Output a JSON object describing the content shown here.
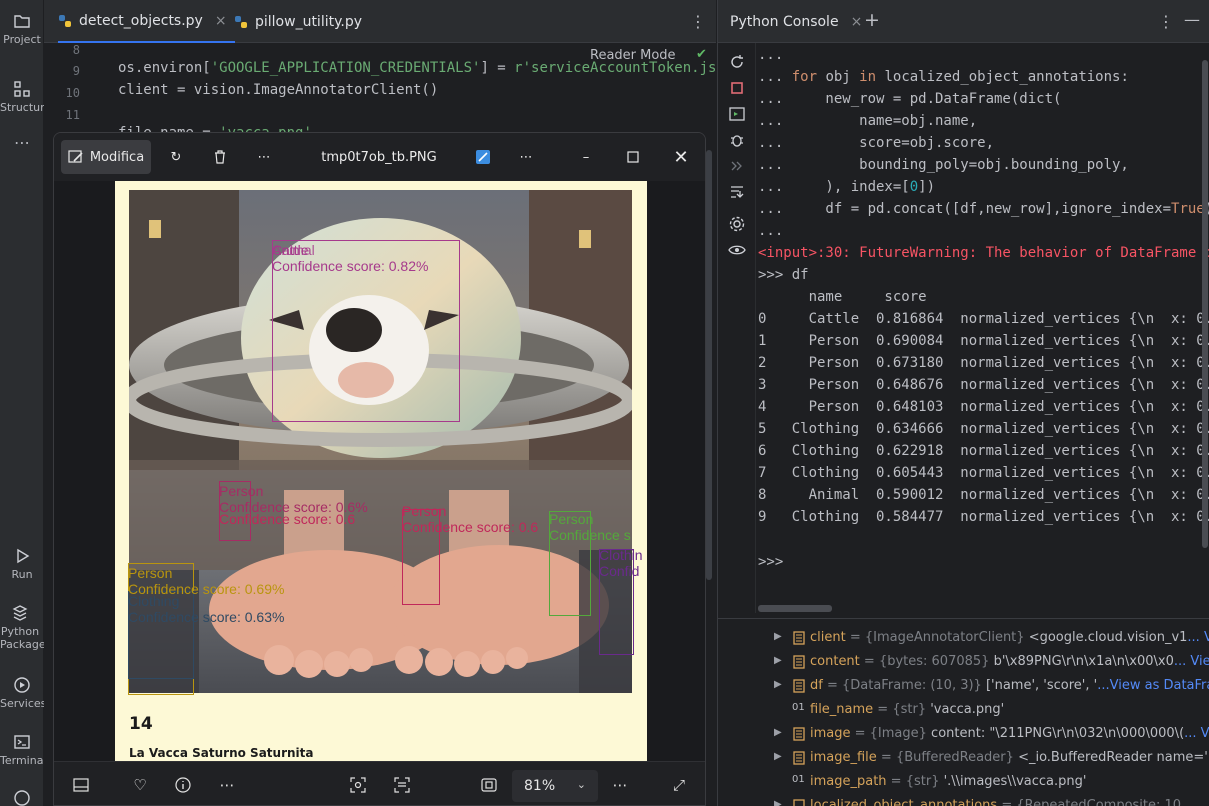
{
  "toolstrip": {
    "project": "Project",
    "structure": "Structure",
    "run": "Run",
    "python_packages": "Python Packages",
    "services": "Services",
    "terminal": "Terminal"
  },
  "editor": {
    "tabs": [
      {
        "label": "detect_objects.py"
      },
      {
        "label": "pillow_utility.py"
      }
    ],
    "reader_mode": "Reader Mode",
    "line_numbers": [
      "8",
      "9",
      "10",
      "11",
      "12"
    ],
    "line9_a": "os.environ[",
    "line9_str": "'GOOGLE_APPLICATION_CREDENTIALS'",
    "line9_b": "] = ",
    "line9_str2": "r'serviceAccountToken.json",
    "line10": "client = vision.ImageAnnotatorClient()",
    "line12_a": "file_name = ",
    "line12_str": "'vacca.png'"
  },
  "viewer": {
    "edit_label": "Modifica",
    "title": "tmp0t7ob_tb.PNG",
    "page_number": "14",
    "caption": "La Vacca Saturno Saturnita",
    "zoom": "81%",
    "detections": [
      {
        "label": "Cattle",
        "score": "Confidence score: 0.82%",
        "color": "#a63a8c"
      },
      {
        "label": "Animal",
        "score": "",
        "color": "#a63a8c"
      },
      {
        "label": "Person",
        "score": "Confidence score: 0.69%",
        "color": "#b9950f"
      },
      {
        "label": "Clothing",
        "score": "Confidence score: 0.63%",
        "color": "#2f4a63"
      },
      {
        "label": "Person",
        "score": "Confidence score: 0.6%",
        "color": "#a62c64"
      },
      {
        "label": "Person",
        "score": "Confidence score: 0.6",
        "color": "#c0285a"
      },
      {
        "label": "Person",
        "score": "Confidence s",
        "color": "#54a83c"
      },
      {
        "label": "Clothin",
        "score": "Confid",
        "color": "#6a2a8c"
      }
    ]
  },
  "console": {
    "tab_label": "Python Console",
    "lines": {
      "l0": "...",
      "l1_a": "... ",
      "l1_kw": "for",
      "l1_b": " obj ",
      "l1_kw2": "in",
      "l1_c": " localized_object_annotations:",
      "l2": "...     new_row = pd.DataFrame(dict(",
      "l3": "...         name=obj.name,",
      "l4": "...         score=obj.score,",
      "l5": "...         bounding_poly=obj.bounding_poly,",
      "l6_a": "...     ), index=[",
      "l6_num": "0",
      "l6_b": "])",
      "l7_a": "...     df = pd.concat([df,new_row],ignore_index=",
      "l7_true": "True",
      "l7_b": ")",
      "l8": "...",
      "warn": "<input>:30: FutureWarning: The behavior of DataFrame conc",
      "prompt_df": ">>> df",
      "header": "      name     score"
    },
    "rows": [
      "0     Cattle  0.816864  normalized_vertices {\\n  x: 0.2949",
      "1     Person  0.690084  normalized_vertices {\\n  x: 0.0240",
      "2     Person  0.673180  normalized_vertices {\\n  x: 0.5390",
      "3     Person  0.648676  normalized_vertices {\\n  x: 0.8164",
      "4     Person  0.648103  normalized_vertices {\\n  x: 0.1953",
      "5   Clothing  0.634666  normalized_vertices {\\n  x: 0.0244",
      "6   Clothing  0.622918  normalized_vertices {\\n  x: 0.9101",
      "7   Clothing  0.605443  normalized_vertices {\\n  x: 0.1962",
      "8     Animal  0.590012  normalized_vertices {\\n  x: 0.2949",
      "9   Clothing  0.584477  normalized_vertices {\\n  x: 0.8242"
    ],
    "prompt_empty": ">>>",
    "variables": [
      {
        "name": "client",
        "type": " = {ImageAnnotatorClient} ",
        "value": "<google.cloud.vision_v1",
        "link": "... View",
        "expandable": true
      },
      {
        "name": "content",
        "type": " = {bytes: 607085} ",
        "value": "b'\\x89PNG\\r\\n\\x1a\\n\\x00\\x0",
        "link": "... View",
        "expandable": true
      },
      {
        "name": "df",
        "type": " = {DataFrame: (10, 3)} ",
        "value": "['name', 'score', '",
        "link": "...View as DataFrame",
        "expandable": true
      },
      {
        "name": "file_name",
        "type": " = {str} ",
        "value": "'vacca.png'",
        "link": "",
        "expandable": false
      },
      {
        "name": "image",
        "type": " = {Image} ",
        "value": "content: \"\\211PNG\\r\\n\\032\\n\\000\\000\\(",
        "link": "... View",
        "expandable": true
      },
      {
        "name": "image_file",
        "type": " = {BufferedReader} ",
        "value": "<_io.BufferedReader name='.\\\\im",
        "link": "",
        "expandable": true
      },
      {
        "name": "image_path",
        "type": " = {str} ",
        "value": "'.\\\\images\\\\vacca.png'",
        "link": "",
        "expandable": false
      },
      {
        "name": "localized_object_annotations",
        "type": " = {RepeatedComposite: 10",
        "value": "",
        "link": "",
        "expandable": true
      }
    ]
  },
  "colors": {
    "accent": "#3574f0",
    "keyword": "#cf8e6d",
    "string": "#6aab73",
    "warning": "#f75464",
    "variable_name": "#d5a35b"
  }
}
